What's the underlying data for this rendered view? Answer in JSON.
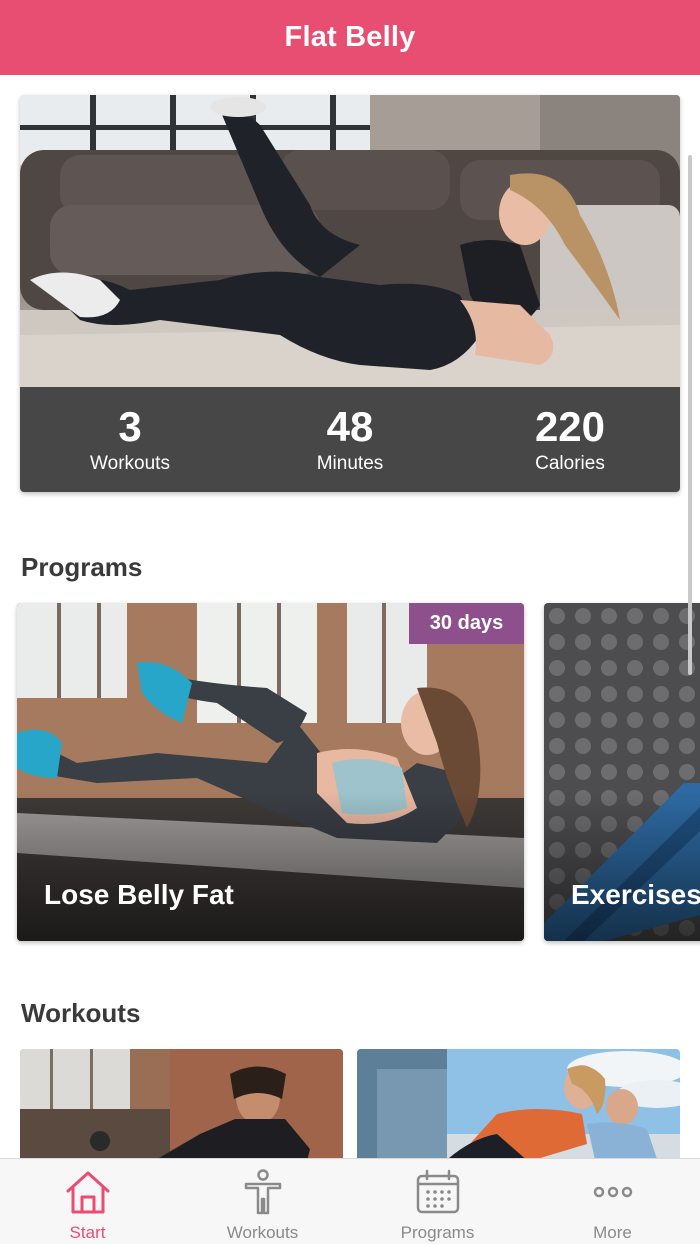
{
  "app": {
    "title": "Flat Belly"
  },
  "hero": {
    "stats": [
      {
        "value": "3",
        "label": "Workouts"
      },
      {
        "value": "48",
        "label": "Minutes"
      },
      {
        "value": "220",
        "label": "Calories"
      }
    ]
  },
  "programs": {
    "title": "Programs",
    "items": [
      {
        "title": "Lose Belly Fat",
        "badge": "30 days"
      },
      {
        "title": "Exercises"
      }
    ]
  },
  "workouts": {
    "title": "Workouts"
  },
  "tabs": [
    {
      "label": "Start",
      "icon": "home-icon",
      "active": true
    },
    {
      "label": "Workouts",
      "icon": "person-icon",
      "active": false
    },
    {
      "label": "Programs",
      "icon": "calendar-icon",
      "active": false
    },
    {
      "label": "More",
      "icon": "more-dots-icon",
      "active": false
    }
  ],
  "colors": {
    "brand": "#e84d72",
    "badge": "#8e4f8d",
    "stats_bg": "#474747",
    "tab_inactive": "#8a8a8a"
  }
}
